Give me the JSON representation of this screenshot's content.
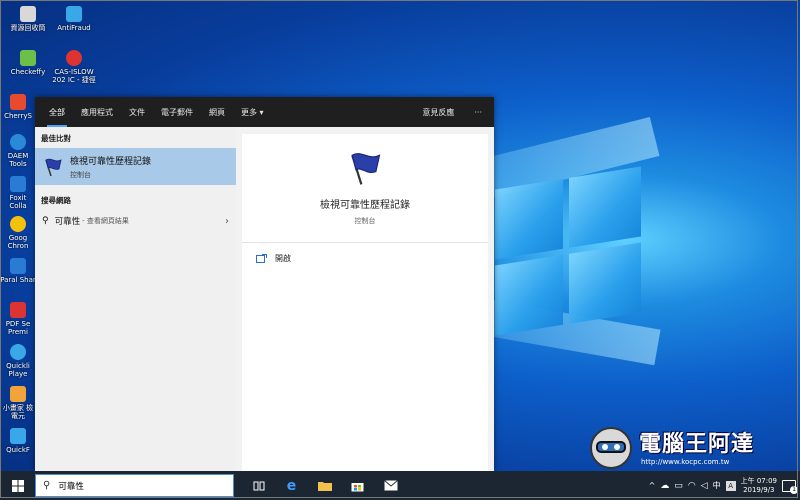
{
  "desktop": {
    "icons": [
      {
        "label": "資源回收筒",
        "color": "#d8d8d8"
      },
      {
        "label": "AntiFraud",
        "color": "#3aa7e8"
      },
      {
        "label": "Checkeffy",
        "color": "#6cc04a"
      },
      {
        "label": "CAS-ISLOW 202 IC - 捷徑",
        "color": "#d33"
      },
      {
        "label": "CherryS",
        "color": "#e84a2f"
      },
      {
        "label": "DAEM Tools",
        "color": "#2b8ad8"
      },
      {
        "label": "Foxit Colla",
        "color": "#2a7bd4"
      },
      {
        "label": "Goog Chron",
        "color": "#f4c20d"
      },
      {
        "label": "Paral Shar",
        "color": "#2a7bd4"
      },
      {
        "label": "PDF Se Premi",
        "color": "#d33"
      },
      {
        "label": "Quickli Playe",
        "color": "#3aa7e8"
      },
      {
        "label": "小畫家 檢電元",
        "color": "#f2a33a"
      },
      {
        "label": "QuickF",
        "color": "#3aa7e8"
      }
    ]
  },
  "start_menu": {
    "tabs": [
      {
        "label": "全部",
        "active": true
      },
      {
        "label": "應用程式"
      },
      {
        "label": "文件"
      },
      {
        "label": "電子郵件"
      },
      {
        "label": "網頁"
      },
      {
        "label": "更多 ▾"
      }
    ],
    "feedback_label": "意見反應",
    "more_label": "···",
    "best_match_header": "最佳比對",
    "best_match": {
      "title": "檢視可靠性歷程記錄",
      "subtitle": "控制台"
    },
    "web_header": "搜尋網路",
    "web_result": {
      "query": "可靠性",
      "suffix": "- 查看網頁結果",
      "chevron": "›"
    },
    "preview": {
      "title": "檢視可靠性歷程記錄",
      "subtitle": "控制台",
      "open_label": "開啟"
    }
  },
  "taskbar": {
    "search_value": "可靠性",
    "clock_time": "上午 07:09",
    "clock_date": "2019/9/3",
    "ime": "中",
    "tray_caret": "^",
    "notify_count": "1"
  },
  "watermark": {
    "text": "電腦王阿達",
    "url": "http://www.kocpc.com.tw"
  },
  "colors": {
    "accent": "#4fa3ff",
    "selected": "#a9c9e8",
    "taskbar": "#1c2532"
  }
}
